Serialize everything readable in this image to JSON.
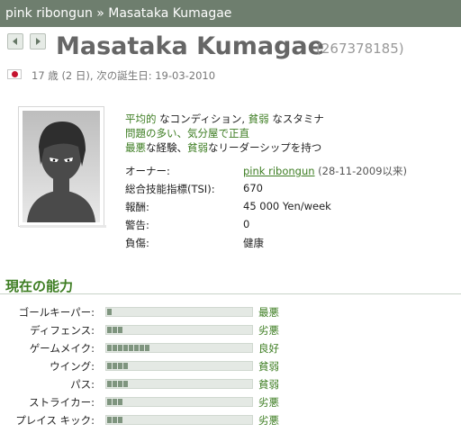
{
  "breadcrumb": "pink ribongun » Masataka Kumagae",
  "nav": {
    "prev_icon": "arrow-left-icon",
    "next_icon": "arrow-right-icon"
  },
  "player": {
    "name": "Masataka Kumagae",
    "id": "(267378185)",
    "nationality_icon": "japan-flag-icon",
    "age_line": "17 歳 (2 日), 次の誕生日: 19-03-2010"
  },
  "traits": {
    "line1": {
      "a": "平均的",
      "b": " なコンディション, ",
      "c": "貧弱",
      "d": " なスタミナ"
    },
    "line2": "問題の多い、気分屋で正直",
    "line3": {
      "a": "最悪",
      "b": "な経験、",
      "c": "貧弱",
      "d": "なリーダーシップを持つ"
    }
  },
  "info": {
    "owner_label": "オーナー:",
    "owner_name": "pink ribongun",
    "owner_since": " (28-11-2009以来)",
    "tsi_label": "総合技能指標(TSI):",
    "tsi_value": "670",
    "salary_label": "報酬:",
    "salary_value": "45 000 Yen/week",
    "warning_label": "警告:",
    "warning_value": "0",
    "injury_label": "負傷:",
    "injury_value": "健康"
  },
  "skills_section": {
    "title": "現在の能力",
    "skills": [
      {
        "label": "ゴールキーパー:",
        "level": "最悪",
        "level_value": 1
      },
      {
        "label": "ディフェンス:",
        "level": "劣悪",
        "level_value": 3
      },
      {
        "label": "ゲームメイク:",
        "level": "良好",
        "level_value": 8
      },
      {
        "label": "ウイング:",
        "level": "貧弱",
        "level_value": 4
      },
      {
        "label": "パス:",
        "level": "貧弱",
        "level_value": 4
      },
      {
        "label": "ストライカー:",
        "level": "劣悪",
        "level_value": 3
      },
      {
        "label": "プレイス キック:",
        "level": "劣悪",
        "level_value": 3
      }
    ]
  },
  "colors": {
    "accent_green": "#3d7d22",
    "topbar": "#6e7e6e",
    "bar_fill": "#7f957f"
  }
}
